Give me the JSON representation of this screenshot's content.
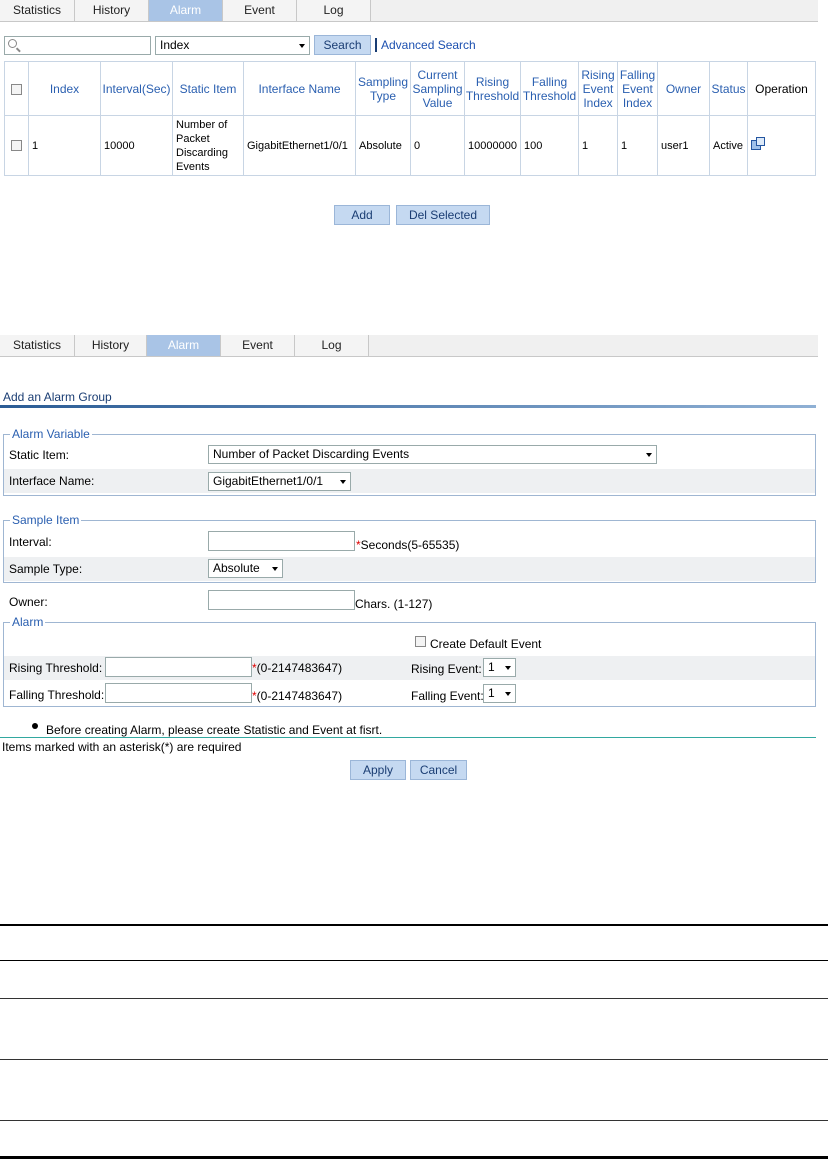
{
  "tabs": [
    "Statistics",
    "History",
    "Alarm",
    "Event",
    "Log"
  ],
  "list": {
    "search_value": "",
    "search_field": "Index",
    "search_button": "Search",
    "advanced_search": "Advanced Search",
    "columns": [
      "Index",
      "Interval(Sec)",
      "Static Item",
      "Interface Name",
      "Sampling Type",
      "Current Sampling Value",
      "Rising Threshold",
      "Falling Threshold",
      "Rising Event Index",
      "Falling Event Index",
      "Owner",
      "Status",
      "Operation"
    ],
    "rows": [
      [
        "1",
        "10000",
        "Number of Packet Discarding Events",
        "GigabitEthernet1/0/1",
        "Absolute",
        "0",
        "10000000",
        "100",
        "1",
        "1",
        "user1",
        "Active"
      ]
    ],
    "add_button": "Add",
    "del_button": "Del Selected"
  },
  "add": {
    "title": "Add an Alarm Group",
    "alarm_variable": {
      "legend": "Alarm Variable",
      "static_item_label": "Static Item:",
      "static_item_value": "Number of Packet Discarding Events",
      "interface_label": "Interface Name:",
      "interface_value": "GigabitEthernet1/0/1"
    },
    "sample_item": {
      "legend": "Sample Item",
      "interval_label": "Interval:",
      "interval_value": "",
      "interval_hint": "Seconds(5-65535)",
      "sample_type_label": "Sample Type:",
      "sample_type_value": "Absolute"
    },
    "owner": {
      "label": "Owner:",
      "value": "",
      "hint": "Chars. (1-127)"
    },
    "alarm": {
      "legend": "Alarm",
      "create_default_event": "Create Default Event",
      "rising_threshold_label": "Rising Threshold:",
      "rising_threshold_value": "",
      "rising_hint": "(0-2147483647)",
      "rising_event_label": "Rising Event:",
      "rising_event_value": "1",
      "falling_threshold_label": "Falling Threshold:",
      "falling_threshold_value": "",
      "falling_hint": "(0-2147483647)",
      "falling_event_label": "Falling Event:",
      "falling_event_value": "1"
    },
    "note": "Before creating Alarm, please create Statistic and Event at fisrt.",
    "required_note": "Items marked with an asterisk(*) are required",
    "asterisk": "*",
    "apply_button": "Apply",
    "cancel_button": "Cancel"
  },
  "colors": {
    "active_tab": "#a9c4e6",
    "button_bg": "#c5d9f1",
    "header_text": "#2a5fb0",
    "required": "#dd0000"
  }
}
